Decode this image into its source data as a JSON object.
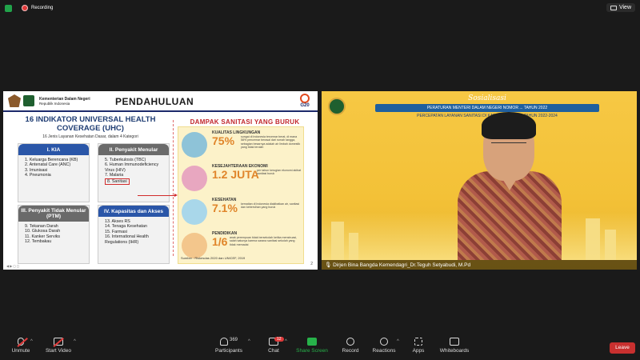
{
  "topbar": {
    "recording_label": "Recording",
    "view_label": "View"
  },
  "slide": {
    "ministry_name": "Kementerian Dalam Negeri",
    "ministry_sub": "Republik Indonesia",
    "title": "PENDAHULUAN",
    "g20": "G20",
    "uhc_title": "16 INDIKATOR UNIVERSAL HEALTH COVERAGE (UHC)",
    "uhc_sub": "16 Jenis Layanan Kesehatan Dasar, dalam 4 Kategori",
    "categories": [
      {
        "title": "I. KIA",
        "items": [
          "1. Keluarga Berencana (KB)",
          "2. Antenatal Care (ANC)",
          "3. Imunisasi",
          "4. Pneumonia"
        ]
      },
      {
        "title": "II. Penyakit Menular",
        "items": [
          "5. Tuberkulosis (TBC)",
          "6. Human Immunodeficiency Virus (HIV)",
          "7. Malaria",
          "8. Sanitasi"
        ]
      },
      {
        "title": "III. Penyakit Tidak Menular (PTM)",
        "items": [
          "9. Tekanan Darah",
          "10. Glukosa Darah",
          "11. Kanker Serviks",
          "12. Tembakau"
        ]
      },
      {
        "title": "IV. Kapasitas dan Akses",
        "items": [
          "13. Akses RS",
          "14. Tenaga Kesehatan",
          "15. Farmasi",
          "16. International Health Regulations (IHR)"
        ]
      }
    ],
    "dampak_title": "DAMPAK SANITASI YANG BURUK",
    "dampak_items": [
      {
        "heading": "KUALITAS LINGKUNGAN",
        "value": "75%",
        "desc": "sungai di Indonesia tercemar berat, di mana 58% pencemar berasal dari rumah tangga, sebagian besarnya adalah air limbah domestik yang tidak terolah"
      },
      {
        "heading": "KESEJAHTERAAN EKONOMI",
        "value": "1.2 JUTA",
        "desc": "per tahun kerugian ekonomi akibat sanitasi buruk"
      },
      {
        "heading": "KESEHATAN",
        "value": "7.1%",
        "desc": "kematian di Indonesia diakibatkan air, sanitasi dan kebersihan yang buruk"
      },
      {
        "heading": "PENDIDIKAN",
        "value": "1/6",
        "desc": "anak perempuan tidak bersekolah ketika menstruasi, salah satunya karena sarana sanitasi sekolah yang tidak memadai"
      }
    ],
    "source": "Sumber : Riskesdas 2020 dan UNICEF, 2019",
    "page_number": "2"
  },
  "camera": {
    "banner_top": "Sosialisasi",
    "banner_strip": "PERATURAN MENTERI DALAM NEGERI NOMOR ... TAHUN 2022",
    "banner_sub": "PERCEPATAN LAYANAN SANITASI DI KABUPATEN/KOTA TAHUN 2022-2024",
    "participant_name": "Dirjen Bina Bangda Kemendagri_Dr.Teguh Setyabudi, M.Pd"
  },
  "toolbar": {
    "unmute": "Unmute",
    "start_video": "Start Video",
    "participants": "Participants",
    "participants_count": "369",
    "chat": "Chat",
    "chat_badge": "12",
    "share_screen": "Share Screen",
    "record": "Record",
    "reactions": "Reactions",
    "apps": "Apps",
    "whiteboards": "Whiteboards",
    "leave": "Leave"
  },
  "colors": {
    "accent_green": "#27b24a",
    "leave_red": "#c8302f",
    "slide_blue": "#2a56a8",
    "slide_red": "#c0272d"
  }
}
